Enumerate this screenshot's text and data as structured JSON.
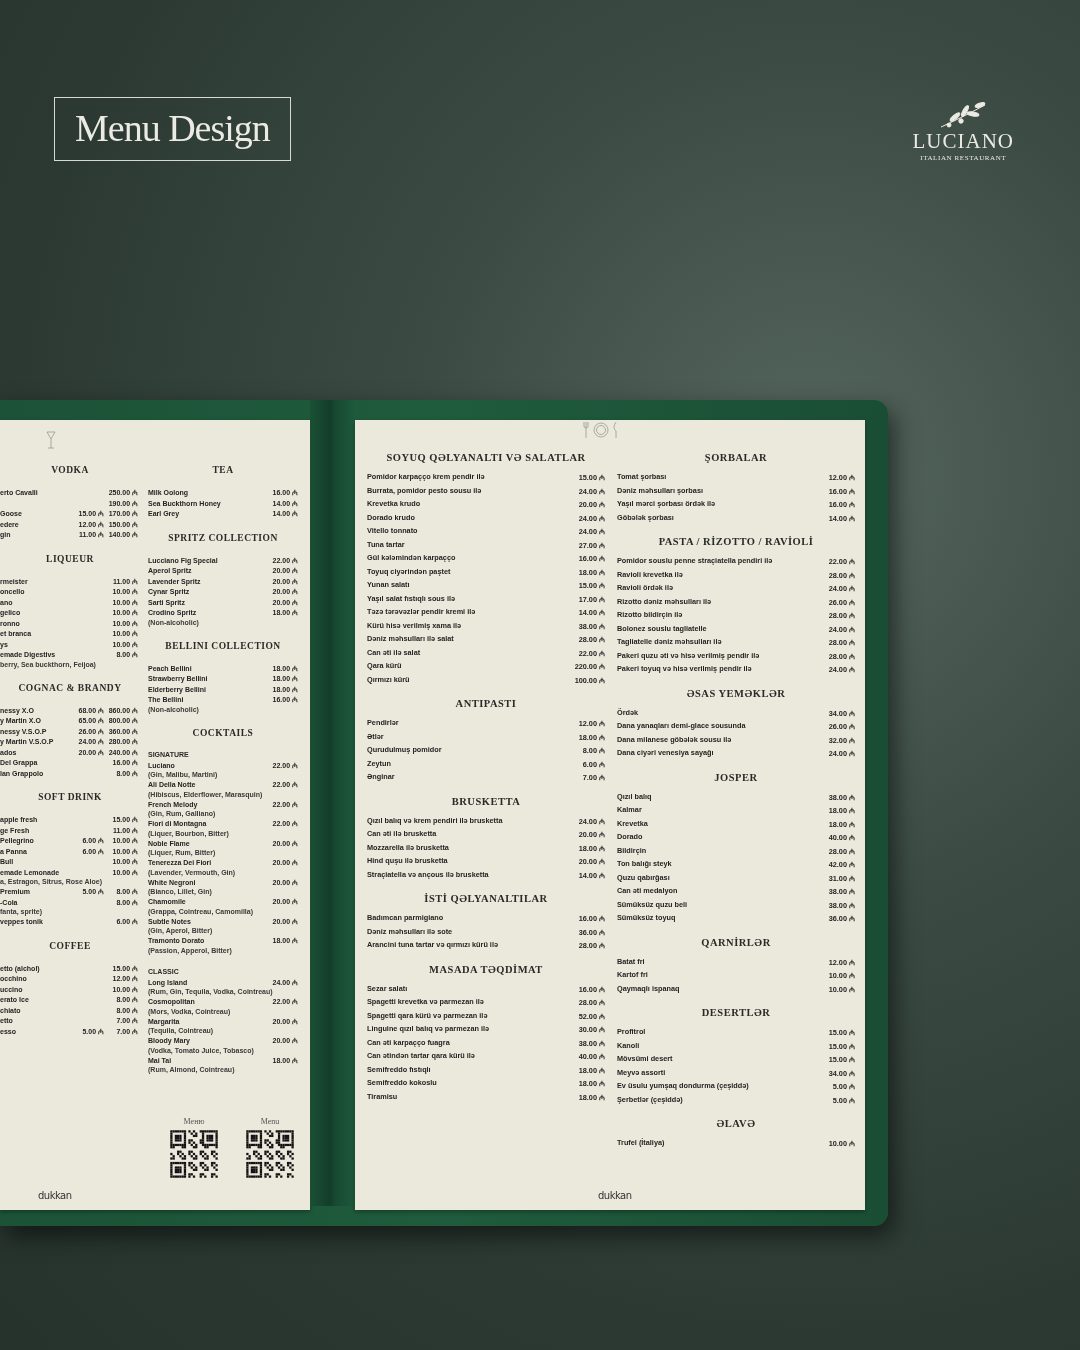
{
  "header": {
    "title": "Menu Design",
    "brand": "LUCIANO",
    "tagline": "ITALIAN RESTAURANT"
  },
  "left_page": {
    "columns": [
      {
        "sections": [
          {
            "title": "VODKA",
            "items": [
              {
                "name": "erto Cavalli",
                "prices": [
                  "250.00 ₼"
                ]
              },
              {
                "prices": [
                  "190.00 ₼"
                ]
              },
              {
                "name": "Goose",
                "prices": [
                  "15.00 ₼",
                  "170.00 ₼"
                ]
              },
              {
                "name": "edere",
                "prices": [
                  "12.00 ₼",
                  "150.00 ₼"
                ]
              },
              {
                "name": "gin",
                "prices": [
                  "11.00 ₼",
                  "140.00 ₼"
                ]
              }
            ]
          },
          {
            "title": "LIQUEUR",
            "items": [
              {
                "name": "rmeister",
                "prices": [
                  "11.00 ₼"
                ]
              },
              {
                "name": "oncello",
                "prices": [
                  "10.00 ₼"
                ]
              },
              {
                "name": "ano",
                "prices": [
                  "10.00 ₼"
                ]
              },
              {
                "name": "gelico",
                "prices": [
                  "10.00 ₼"
                ]
              },
              {
                "name": "ronno",
                "prices": [
                  "10.00 ₼"
                ]
              },
              {
                "name": "et branca",
                "prices": [
                  "10.00 ₼"
                ]
              },
              {
                "name": "ys",
                "prices": [
                  "10.00 ₼"
                ]
              },
              {
                "name": "emade Digestivs",
                "note": "berry, Sea buckthorn, Feijoa)",
                "prices": [
                  "8.00 ₼"
                ]
              }
            ]
          },
          {
            "title": "COGNAC & BRANDY",
            "items": [
              {
                "name": "nessy X.O",
                "prices": [
                  "68.00 ₼",
                  "860.00 ₼"
                ]
              },
              {
                "name": "y Martin X.O",
                "prices": [
                  "65.00 ₼",
                  "800.00 ₼"
                ]
              },
              {
                "name": "nessy V.S.O.P",
                "prices": [
                  "26.00 ₼",
                  "360.00 ₼"
                ]
              },
              {
                "name": "y Martin V.S.O.P",
                "prices": [
                  "24.00 ₼",
                  "280.00 ₼"
                ]
              },
              {
                "name": "ados",
                "prices": [
                  "20.00 ₼",
                  "240.00 ₼"
                ]
              },
              {
                "name": "Del Grappa",
                "prices": [
                  "16.00 ₼"
                ]
              },
              {
                "name": "lan Grappolo",
                "prices": [
                  "8.00 ₼"
                ]
              }
            ]
          },
          {
            "title": "SOFT DRINK",
            "items": [
              {
                "name": "apple fresh",
                "prices": [
                  "15.00 ₼"
                ]
              },
              {
                "name": "ge Fresh",
                "prices": [
                  "11.00 ₼"
                ]
              },
              {
                "name": "Pellegrino",
                "prices": [
                  "6.00 ₼",
                  "10.00 ₼"
                ]
              },
              {
                "name": "a Panna",
                "prices": [
                  "6.00 ₼",
                  "10.00 ₼"
                ]
              },
              {
                "name": "Bull",
                "prices": [
                  "10.00 ₼"
                ]
              },
              {
                "name": "emade Lemonade",
                "note": "a, Estragon, Sitrus, Rose Aloe)",
                "prices": [
                  "10.00 ₼"
                ]
              },
              {
                "name": "Premium",
                "prices": [
                  "5.00 ₼",
                  "8.00 ₼"
                ]
              },
              {
                "name": "-Cola",
                "note": "fanta, sprite)",
                "prices": [
                  "8.00 ₼"
                ]
              },
              {
                "name": "veppes tonik",
                "prices": [
                  "6.00 ₼"
                ]
              }
            ]
          },
          {
            "title": "COFFEE",
            "items": [
              {
                "name": "etto (alchol)",
                "prices": [
                  "15.00 ₼"
                ]
              },
              {
                "name": "occhino",
                "prices": [
                  "12.00 ₼"
                ]
              },
              {
                "name": "uccino",
                "prices": [
                  "10.00 ₼"
                ]
              },
              {
                "name": "erato Ice",
                "prices": [
                  "8.00 ₼"
                ]
              },
              {
                "name": "chiato",
                "prices": [
                  "8.00 ₼"
                ]
              },
              {
                "name": "etto",
                "prices": [
                  "7.00 ₼"
                ]
              },
              {
                "name": "esso",
                "prices": [
                  "5.00 ₼",
                  "7.00 ₼"
                ]
              }
            ]
          }
        ]
      },
      {
        "sections": [
          {
            "title": "TEA",
            "items": [
              {
                "name": "Milk Oolong",
                "prices": [
                  "16.00 ₼"
                ]
              },
              {
                "name": "Sea Buckthorn Honey",
                "prices": [
                  "14.00 ₼"
                ]
              },
              {
                "name": "Earl Grey",
                "prices": [
                  "14.00 ₼"
                ]
              }
            ]
          },
          {
            "title": "SPRITZ COLLECTION",
            "items": [
              {
                "name": "Lucciano Fig Special",
                "prices": [
                  "22.00 ₼"
                ]
              },
              {
                "name": "Aperol Spritz",
                "prices": [
                  "20.00 ₼"
                ]
              },
              {
                "name": "Lavender Spritz",
                "prices": [
                  "20.00 ₼"
                ]
              },
              {
                "name": "Cynar Spritz",
                "prices": [
                  "20.00 ₼"
                ]
              },
              {
                "name": "Sarti Spritz",
                "prices": [
                  "20.00 ₼"
                ]
              },
              {
                "name": "Crodino Spritz",
                "note": "(Non-alcoholic)",
                "prices": [
                  "18.00 ₼"
                ]
              }
            ]
          },
          {
            "title": "BELLINI COLLECTION",
            "items": [
              {
                "name": "Peach Bellini",
                "prices": [
                  "18.00 ₼"
                ]
              },
              {
                "name": "Strawberry Bellini",
                "prices": [
                  "18.00 ₼"
                ]
              },
              {
                "name": "Elderberry Bellini",
                "prices": [
                  "18.00 ₼"
                ]
              },
              {
                "name": "The Bellini",
                "note": "(Non-alcoholic)",
                "prices": [
                  "16.00 ₼"
                ]
              }
            ]
          },
          {
            "title": "COCKTAILS",
            "subtitle": "SIGNATURE",
            "items": [
              {
                "name": "Luciano",
                "note": "(Gin, Malibu, Martini)",
                "prices": [
                  "22.00 ₼"
                ]
              },
              {
                "name": "Ali Della Notte",
                "note": "(Hibiscus, Elderflower, Marasquin)",
                "prices": [
                  "22.00 ₼"
                ]
              },
              {
                "name": "French Melody",
                "note": "(Gin, Rum, Galliano)",
                "prices": [
                  "22.00 ₼"
                ]
              },
              {
                "name": "Fiori di Montagna",
                "note": "(Liquer, Bourbon, Bitter)",
                "prices": [
                  "22.00 ₼"
                ]
              },
              {
                "name": "Noble Flame",
                "note": "(Liquer, Rum, Bitter)",
                "prices": [
                  "20.00 ₼"
                ]
              },
              {
                "name": "Tenerezza Dei Fiori",
                "note": "(Lavender, Vermouth, Gin)",
                "prices": [
                  "20.00 ₼"
                ]
              },
              {
                "name": "White Negroni",
                "note": "(Bianco, Lillet, Gin)",
                "prices": [
                  "20.00 ₼"
                ]
              },
              {
                "name": "Chamomile",
                "note": "(Grappa, Cointreau, Camomilla)",
                "prices": [
                  "20.00 ₼"
                ]
              },
              {
                "name": "Subtle Notes",
                "note": "(Gin, Aperol, Bitter)",
                "prices": [
                  "20.00 ₼"
                ]
              },
              {
                "name": "Tramonto Dorato",
                "note": "(Passion, Apperol, Bitter)",
                "prices": [
                  "18.00 ₼"
                ]
              }
            ]
          },
          {
            "subtitle": "CLASSIC",
            "items": [
              {
                "name": "Long Island",
                "note": "(Rum, Gin, Tequila, Vodka, Cointreau)",
                "prices": [
                  "24.00 ₼"
                ]
              },
              {
                "name": "Cosmopolitan",
                "note": "(Mors, Vodka, Cointreau)",
                "prices": [
                  "22.00 ₼"
                ]
              },
              {
                "name": "Margarita",
                "note": "(Tequila, Cointreau)",
                "prices": [
                  "20.00 ₼"
                ]
              },
              {
                "name": "Bloody Mary",
                "note": "(Vodka, Tomato Juice, Tobasco)",
                "prices": [
                  "20.00 ₼"
                ]
              },
              {
                "name": "Mai Tai",
                "note": "(Rum, Almond, Cointreau)",
                "prices": [
                  "18.00 ₼"
                ]
              }
            ]
          }
        ]
      }
    ],
    "qr_codes": [
      {
        "label": "Меню"
      },
      {
        "label": "Menu"
      }
    ],
    "footer_logo": "dukkan"
  },
  "right_page": {
    "columns": [
      {
        "sections": [
          {
            "title": "SOYUQ QƏLYANALTI VƏ SALATLAR",
            "items": [
              {
                "name": "Pomidor karpaçço krem pendir ilə",
                "prices": [
                  "15.00 ₼"
                ]
              },
              {
                "name": "Burrata, pomidor pesto sousu ilə",
                "prices": [
                  "24.00 ₼"
                ]
              },
              {
                "name": "Krevetka krudo",
                "prices": [
                  "20.00 ₼"
                ]
              },
              {
                "name": "Dorado krudo",
                "prices": [
                  "24.00 ₼"
                ]
              },
              {
                "name": "Vitello tonnato",
                "prices": [
                  "24.00 ₼"
                ]
              },
              {
                "name": "Tuna tartar",
                "prices": [
                  "27.00 ₼"
                ]
              },
              {
                "name": "Gül kələmindən karpaçço",
                "prices": [
                  "16.00 ₼"
                ]
              },
              {
                "name": "Toyuq ciyərindən paştet",
                "prices": [
                  "18.00 ₼"
                ]
              },
              {
                "name": "Yunan salatı",
                "prices": [
                  "15.00 ₼"
                ]
              },
              {
                "name": "Yaşıl salat fıstıqlı sous ilə",
                "prices": [
                  "17.00 ₼"
                ]
              },
              {
                "name": "Təzə tərəvəzlər pendir kremi ilə",
                "prices": [
                  "14.00 ₼"
                ]
              },
              {
                "name": "Kürü hisə verilmiş xama ilə",
                "prices": [
                  "38.00 ₼"
                ]
              },
              {
                "name": "Dəniz məhsulları ilə salat",
                "prices": [
                  "28.00 ₼"
                ]
              },
              {
                "name": "Can əti ilə salat",
                "prices": [
                  "22.00 ₼"
                ]
              },
              {
                "name": "Qara kürü",
                "prices": [
                  "220.00 ₼"
                ]
              },
              {
                "name": "Qırmızı kürü",
                "prices": [
                  "100.00 ₼"
                ]
              }
            ]
          },
          {
            "title": "ANTIPASTI",
            "items": [
              {
                "name": "Pendirlər",
                "prices": [
                  "12.00 ₼"
                ]
              },
              {
                "name": "Ətlər",
                "prices": [
                  "18.00 ₼"
                ]
              },
              {
                "name": "Qurudulmuş pomidor",
                "prices": [
                  "8.00 ₼"
                ]
              },
              {
                "name": "Zeytun",
                "prices": [
                  "6.00 ₼"
                ]
              },
              {
                "name": "Ənginar",
                "prices": [
                  "7.00 ₼"
                ]
              }
            ]
          },
          {
            "title": "BRUSKETTA",
            "items": [
              {
                "name": "Qızıl balıq və krem pendiri ilə brusketta",
                "prices": [
                  "24.00 ₼"
                ]
              },
              {
                "name": "Can əti ilə brusketta",
                "prices": [
                  "20.00 ₼"
                ]
              },
              {
                "name": "Mozzarella ilə brusketta",
                "prices": [
                  "18.00 ₼"
                ]
              },
              {
                "name": "Hind quşu ilə brusketta",
                "prices": [
                  "20.00 ₼"
                ]
              },
              {
                "name": "Straçiatella və ançous ilə brusketta",
                "prices": [
                  "14.00 ₼"
                ]
              }
            ]
          },
          {
            "title": "İSTİ QƏLYANALTILAR",
            "items": [
              {
                "name": "Badımcan parmigiano",
                "prices": [
                  "16.00 ₼"
                ]
              },
              {
                "name": "Dəniz məhsulları ilə sote",
                "prices": [
                  "36.00 ₼"
                ]
              },
              {
                "name": "Arancini tuna tartar və qırmızı kürü ilə",
                "prices": [
                  "28.00 ₼"
                ]
              }
            ]
          },
          {
            "title": "MASADA TƏQDİMAT",
            "items": [
              {
                "name": "Sezar salatı",
                "prices": [
                  "16.00 ₼"
                ]
              },
              {
                "name": "Spagetti krevetka və parmezan ilə",
                "prices": [
                  "28.00 ₼"
                ]
              },
              {
                "name": "Spagetti qara kürü və parmezan ilə",
                "prices": [
                  "52.00 ₼"
                ]
              },
              {
                "name": "Linguine qızıl balıq və parmezan ilə",
                "prices": [
                  "30.00 ₼"
                ]
              },
              {
                "name": "Can əti karpaçço fuagra",
                "prices": [
                  "38.00 ₼"
                ]
              },
              {
                "name": "Can ətindən tartar qara kürü ilə",
                "prices": [
                  "40.00 ₼"
                ]
              },
              {
                "name": "Semifreddo fıstıqlı",
                "prices": [
                  "18.00 ₼"
                ]
              },
              {
                "name": "Semifreddo kokoslu",
                "prices": [
                  "18.00 ₼"
                ]
              },
              {
                "name": "Tiramisu",
                "prices": [
                  "18.00 ₼"
                ]
              }
            ]
          }
        ]
      },
      {
        "sections": [
          {
            "title": "ŞORBALAR",
            "items": [
              {
                "name": "Tomat şorbası",
                "prices": [
                  "12.00 ₼"
                ]
              },
              {
                "name": "Dəniz məhsulları şorbası",
                "prices": [
                  "16.00 ₼"
                ]
              },
              {
                "name": "Yaşıl mərci şorbası ördək ilə",
                "prices": [
                  "16.00 ₼"
                ]
              },
              {
                "name": "Göbələk şorbası",
                "prices": [
                  "14.00 ₼"
                ]
              }
            ]
          },
          {
            "title": "PASTA / RİZOTTO / RAVİOLİ",
            "items": [
              {
                "name": "Pomidor souslu penne straçiatella pendiri ilə",
                "prices": [
                  "22.00 ₼"
                ]
              },
              {
                "name": "Ravioli krevetka ilə",
                "prices": [
                  "28.00 ₼"
                ]
              },
              {
                "name": "Ravioli ördək ilə",
                "prices": [
                  "24.00 ₼"
                ]
              },
              {
                "name": "Rizotto dəniz məhsulları ilə",
                "prices": [
                  "26.00 ₼"
                ]
              },
              {
                "name": "Rizotto bildirçin ilə",
                "prices": [
                  "28.00 ₼"
                ]
              },
              {
                "name": "Bolonez souslu tagliatelle",
                "prices": [
                  "24.00 ₼"
                ]
              },
              {
                "name": "Tagliatelle dəniz məhsulları ilə",
                "prices": [
                  "28.00 ₼"
                ]
              },
              {
                "name": "Pakeri quzu əti və hisə verilmiş pendir ilə",
                "prices": [
                  "28.00 ₼"
                ]
              },
              {
                "name": "Pakeri toyuq və hisə verilmiş pendir ilə",
                "prices": [
                  "24.00 ₼"
                ]
              }
            ]
          },
          {
            "title": "ƏSAS YEMƏKLƏR",
            "items": [
              {
                "name": "Ördək",
                "prices": [
                  "34.00 ₼"
                ]
              },
              {
                "name": "Dana yanaqları demi-glace sousunda",
                "prices": [
                  "26.00 ₼"
                ]
              },
              {
                "name": "Dana milanese göbələk sousu ilə",
                "prices": [
                  "32.00 ₼"
                ]
              },
              {
                "name": "Dana ciyəri venesiya sayağı",
                "prices": [
                  "24.00 ₼"
                ]
              }
            ]
          },
          {
            "title": "JOSPER",
            "items": [
              {
                "name": "Qızıl balıq",
                "prices": [
                  "38.00 ₼"
                ]
              },
              {
                "name": "Kalmar",
                "prices": [
                  "18.00 ₼"
                ]
              },
              {
                "name": "Krevetka",
                "prices": [
                  "18.00 ₼"
                ]
              },
              {
                "name": "Dorado",
                "prices": [
                  "40.00 ₼"
                ]
              },
              {
                "name": "Bildirçin",
                "prices": [
                  "28.00 ₼"
                ]
              },
              {
                "name": "Ton balığı steyk",
                "prices": [
                  "42.00 ₼"
                ]
              },
              {
                "name": "Quzu qabırğası",
                "prices": [
                  "31.00 ₼"
                ]
              },
              {
                "name": "Can əti medalyon",
                "prices": [
                  "38.00 ₼"
                ]
              },
              {
                "name": "Sümüksüz quzu beli",
                "prices": [
                  "38.00 ₼"
                ]
              },
              {
                "name": "Sümüksüz toyuq",
                "prices": [
                  "36.00 ₼"
                ]
              }
            ]
          },
          {
            "title": "QARNİRLƏR",
            "items": [
              {
                "name": "Batat fri",
                "prices": [
                  "12.00 ₼"
                ]
              },
              {
                "name": "Kartof fri",
                "prices": [
                  "10.00 ₼"
                ]
              },
              {
                "name": "Qaymaqlı ispanaq",
                "prices": [
                  "10.00 ₼"
                ]
              }
            ]
          },
          {
            "title": "DESERTLƏR",
            "items": [
              {
                "name": "Profitrol",
                "prices": [
                  "15.00 ₼"
                ]
              },
              {
                "name": "Kanoli",
                "prices": [
                  "15.00 ₼"
                ]
              },
              {
                "name": "Mövsümi desert",
                "prices": [
                  "15.00 ₼"
                ]
              },
              {
                "name": "Meyvə assorti",
                "prices": [
                  "34.00 ₼"
                ]
              },
              {
                "name": "Ev üsulu yumşaq dondurma (çeşiddə)",
                "prices": [
                  "5.00 ₼"
                ]
              },
              {
                "name": "Şerbetlər (çeşiddə)",
                "prices": [
                  "5.00 ₼"
                ]
              }
            ]
          },
          {
            "title": "ƏLAVƏ",
            "items": [
              {
                "name": "Trufel (İtaliya)",
                "prices": [
                  "10.00 ₼"
                ]
              }
            ]
          }
        ]
      }
    ],
    "footer_logo": "dukkan"
  }
}
